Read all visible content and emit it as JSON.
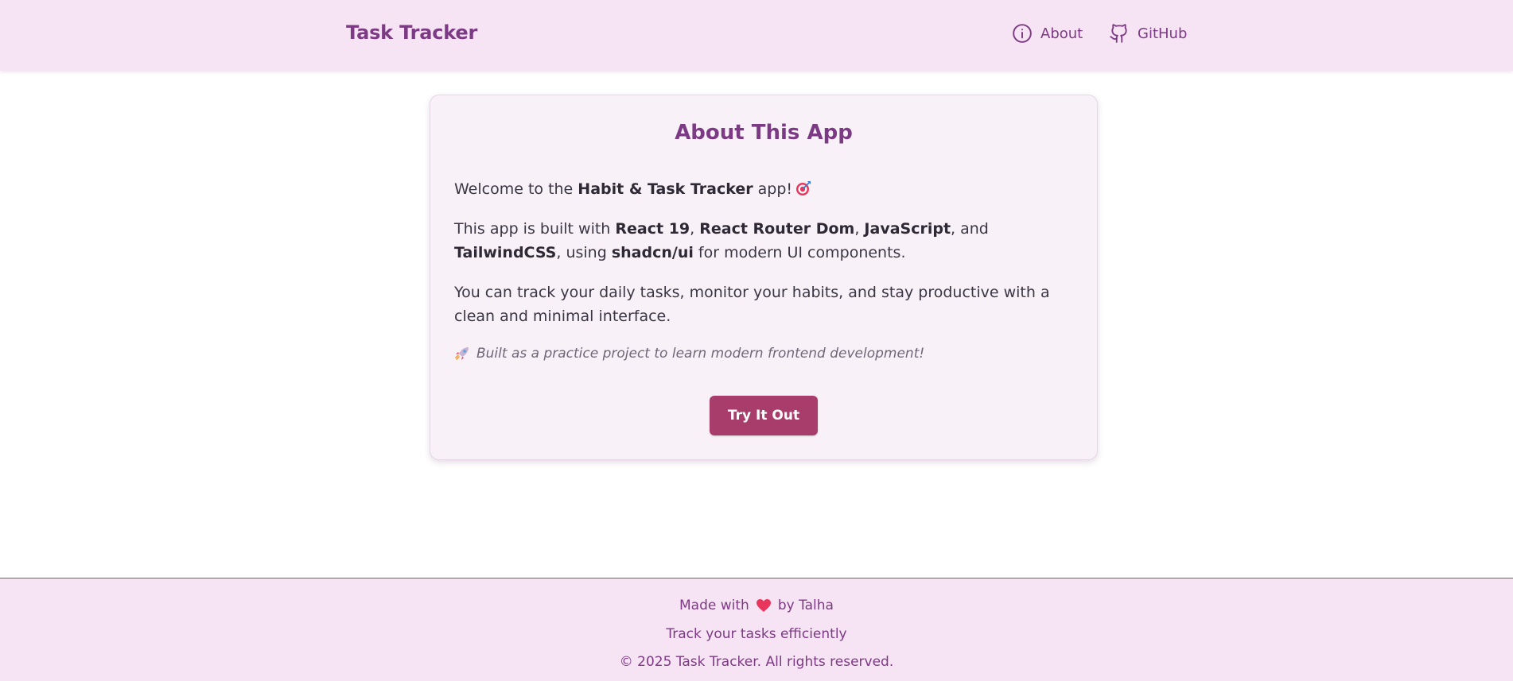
{
  "header": {
    "brand": "Task Tracker",
    "nav": {
      "about": {
        "label": "About",
        "icon": "info-icon"
      },
      "github": {
        "label": "GitHub",
        "icon": "github-icon"
      }
    }
  },
  "card": {
    "title": "About This App",
    "p1": {
      "before": "Welcome to the ",
      "bold": "Habit & Task Tracker",
      "after": " app!",
      "emoji": "target-icon"
    },
    "p2": {
      "t1": "This app is built with ",
      "b1": "React 19",
      "t2": ", ",
      "b2": "React Router Dom",
      "t3": ", ",
      "b3": "JavaScript",
      "t4": ", and ",
      "b4": "TailwindCSS",
      "t5": ", using ",
      "b5": "shadcn/ui",
      "t6": " for modern UI components."
    },
    "p3": "You can track your daily tasks, monitor your habits, and stay productive with a clean and minimal interface.",
    "note": "Built as a practice project to learn modern frontend development!",
    "cta": "Try It Out"
  },
  "footer": {
    "made_before": "Made with",
    "made_after": "by Talha",
    "tagline": "Track your tasks efficiently",
    "copyright": "© 2025 Task Tracker. All rights reserved."
  },
  "colors": {
    "header_bg": "#f6e3f3",
    "brand": "#7d3a84",
    "card_bg": "#f8f1f8",
    "button": "#a83d6c"
  }
}
